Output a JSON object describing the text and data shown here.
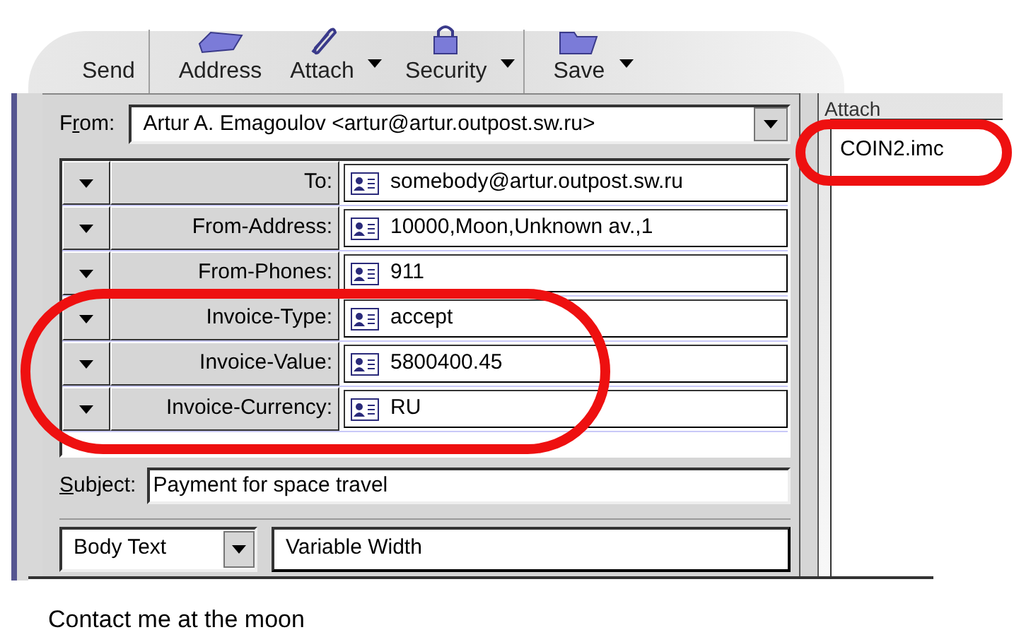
{
  "toolbar": [
    {
      "label": "Send",
      "dropdown": false
    },
    {
      "label": "Address",
      "dropdown": false
    },
    {
      "label": "Attach",
      "dropdown": true
    },
    {
      "label": "Security",
      "dropdown": true
    },
    {
      "label": "Save",
      "dropdown": true
    }
  ],
  "from": {
    "label": {
      "before": "F",
      "mnemonic": "r",
      "after": "om:"
    },
    "value": "Artur A. Emagoulov <artur@artur.outpost.sw.ru>"
  },
  "header_fields": [
    {
      "label": "To:",
      "value": "somebody@artur.outpost.sw.ru"
    },
    {
      "label": "From-Address:",
      "value": "10000,Moon,Unknown av.,1"
    },
    {
      "label": "From-Phones:",
      "value": "911"
    },
    {
      "label": "Invoice-Type:",
      "value": "accept"
    },
    {
      "label": "Invoice-Value:",
      "value": "5800400.45"
    },
    {
      "label": "Invoice-Currency:",
      "value": "RU"
    }
  ],
  "subject": {
    "label": {
      "mnemonic": "S",
      "after": "ubject:"
    },
    "value": "Payment for space travel"
  },
  "format_bar": {
    "paragraph_style": "Body Text",
    "font": "Variable Width"
  },
  "attachments": {
    "title": "Attach",
    "items": [
      "COIN2.imc"
    ]
  },
  "body": "Contact me at the moon"
}
